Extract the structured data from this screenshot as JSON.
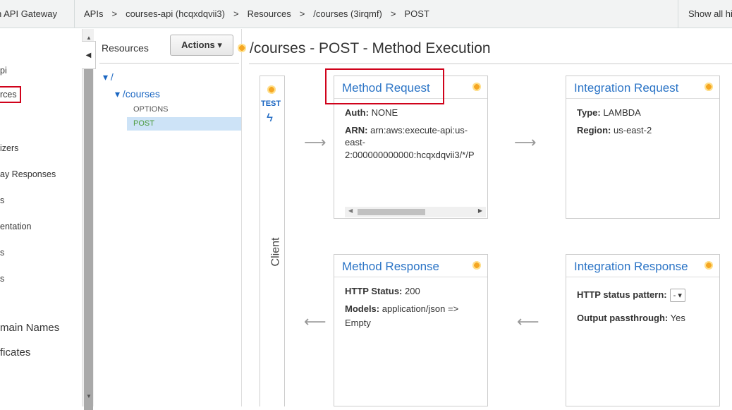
{
  "topbar": {
    "app_name": "n API Gateway",
    "breadcrumbs": [
      "APIs",
      "courses-api (hcqxdqvii3)",
      "Resources",
      "/courses (3irqmf)",
      "POST"
    ],
    "separator": ">",
    "show_all": "Show all hi"
  },
  "leftnav": {
    "items": [
      "pi",
      "rces",
      "izers",
      "ay Responses",
      "s",
      "entation",
      "s",
      "s"
    ],
    "big_items": [
      "main Names",
      "ficates"
    ]
  },
  "resources": {
    "title": "Resources",
    "actions_label": "Actions",
    "tree": {
      "root": "/",
      "child": "/courses",
      "methods": [
        "OPTIONS",
        "POST"
      ]
    }
  },
  "main": {
    "title": "/courses - POST - Method Execution",
    "client": {
      "test_label": "TEST",
      "label": "Client"
    },
    "method_request": {
      "title": "Method Request",
      "auth_label": "Auth:",
      "auth_value": "NONE",
      "arn_label": "ARN:",
      "arn_line1": "arn:aws:execute-api:us-",
      "arn_line2": "east-",
      "arn_line3": "2:000000000000:hcqxdqvii3/*/P"
    },
    "integration_request": {
      "title": "Integration Request",
      "type_label": "Type:",
      "type_value": "LAMBDA",
      "region_label": "Region:",
      "region_value": "us-east-2"
    },
    "method_response": {
      "title": "Method Response",
      "status_label": "HTTP Status:",
      "status_value": "200",
      "models_label": "Models:",
      "models_value": "application/json =>",
      "models_value2": "Empty"
    },
    "integration_response": {
      "title": "Integration Response",
      "pattern_label": "HTTP status pattern:",
      "pattern_value": "-",
      "passthrough_label": "Output passthrough:",
      "passthrough_value": "Yes"
    }
  },
  "colors": {
    "accent_blue": "#2b74c6",
    "highlight_red": "#d0021b",
    "selected_bg": "#cde3f7"
  }
}
